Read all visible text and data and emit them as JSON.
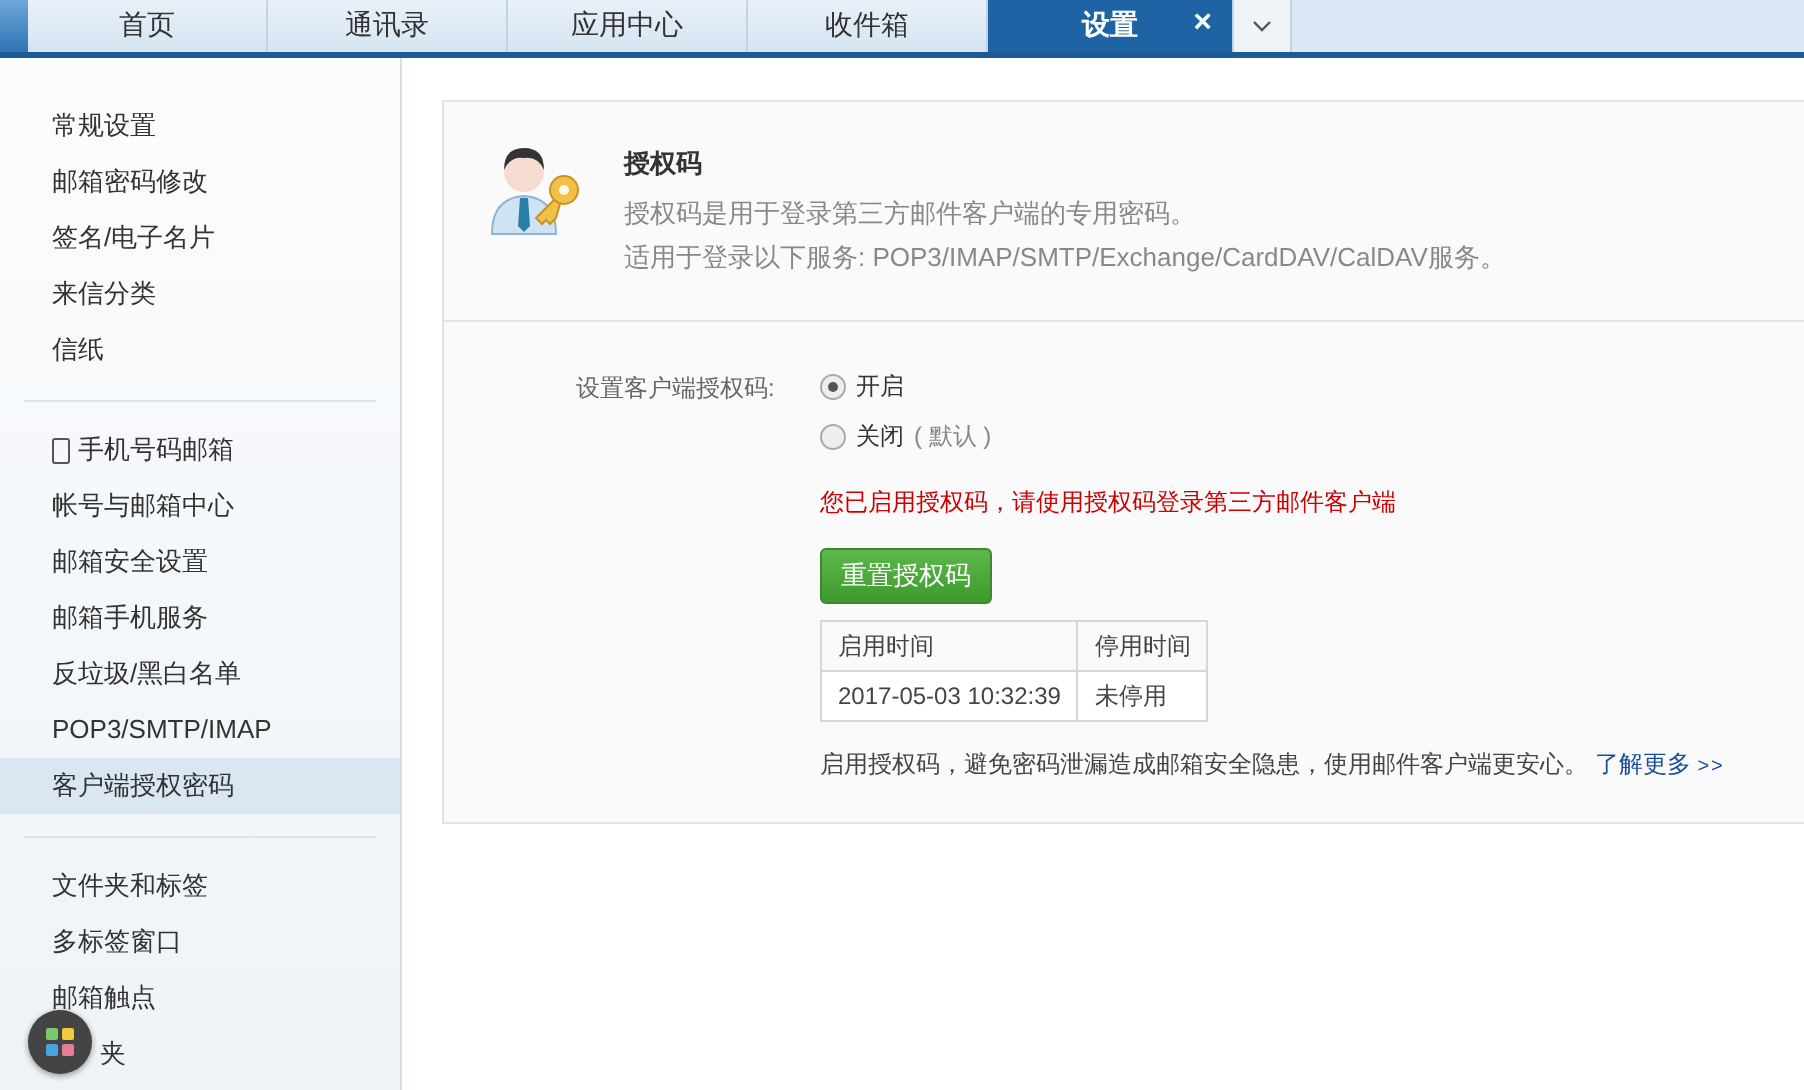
{
  "tabs": [
    {
      "label": "首页",
      "selected": false
    },
    {
      "label": "通讯录",
      "selected": false
    },
    {
      "label": "应用中心",
      "selected": false
    },
    {
      "label": "收件箱",
      "selected": false
    },
    {
      "label": "设置",
      "selected": true,
      "close": "×"
    }
  ],
  "sidebar": {
    "groups": [
      [
        {
          "label": "常规设置",
          "selected": false
        },
        {
          "label": "邮箱密码修改",
          "selected": false
        },
        {
          "label": "签名/电子名片",
          "selected": false
        },
        {
          "label": "来信分类",
          "selected": false
        },
        {
          "label": "信纸",
          "selected": false
        }
      ],
      [
        {
          "label": "手机号码邮箱",
          "selected": false,
          "phone_icon": true
        },
        {
          "label": "帐号与邮箱中心",
          "selected": false
        },
        {
          "label": "邮箱安全设置",
          "selected": false
        },
        {
          "label": "邮箱手机服务",
          "selected": false
        },
        {
          "label": "反垃圾/黑白名单",
          "selected": false
        },
        {
          "label": "POP3/SMTP/IMAP",
          "selected": false
        },
        {
          "label": "客户端授权密码",
          "selected": true
        }
      ],
      [
        {
          "label": "文件夹和标签",
          "selected": false
        },
        {
          "label": "多标签窗口",
          "selected": false
        },
        {
          "label": "邮箱触点",
          "selected": false
        },
        {
          "label": "夹",
          "selected": false,
          "covered": true
        }
      ]
    ]
  },
  "header": {
    "title": "授权码",
    "description": "授权码是用于登录第三方邮件客户端的专用密码。",
    "services": "适用于登录以下服务: POP3/IMAP/SMTP/Exchange/CardDAV/CalDAV服务。"
  },
  "setting": {
    "label": "设置客户端授权码:",
    "options": [
      {
        "label": "开启",
        "selected": true
      },
      {
        "label": "关闭",
        "note": "( 默认 )",
        "selected": false
      }
    ],
    "notice": "您已启用授权码，请使用授权码登录第三方邮件客户端",
    "button": "重置授权码",
    "table": {
      "columns": [
        "启用时间",
        "停用时间"
      ],
      "rows": [
        [
          "2017-05-03 10:32:39",
          "未停用"
        ]
      ]
    },
    "footer": "启用授权码，避免密码泄漏造成邮箱安全隐患，使用邮件客户端更安心。",
    "link": "了解更多",
    "link_arrows": ">>"
  }
}
